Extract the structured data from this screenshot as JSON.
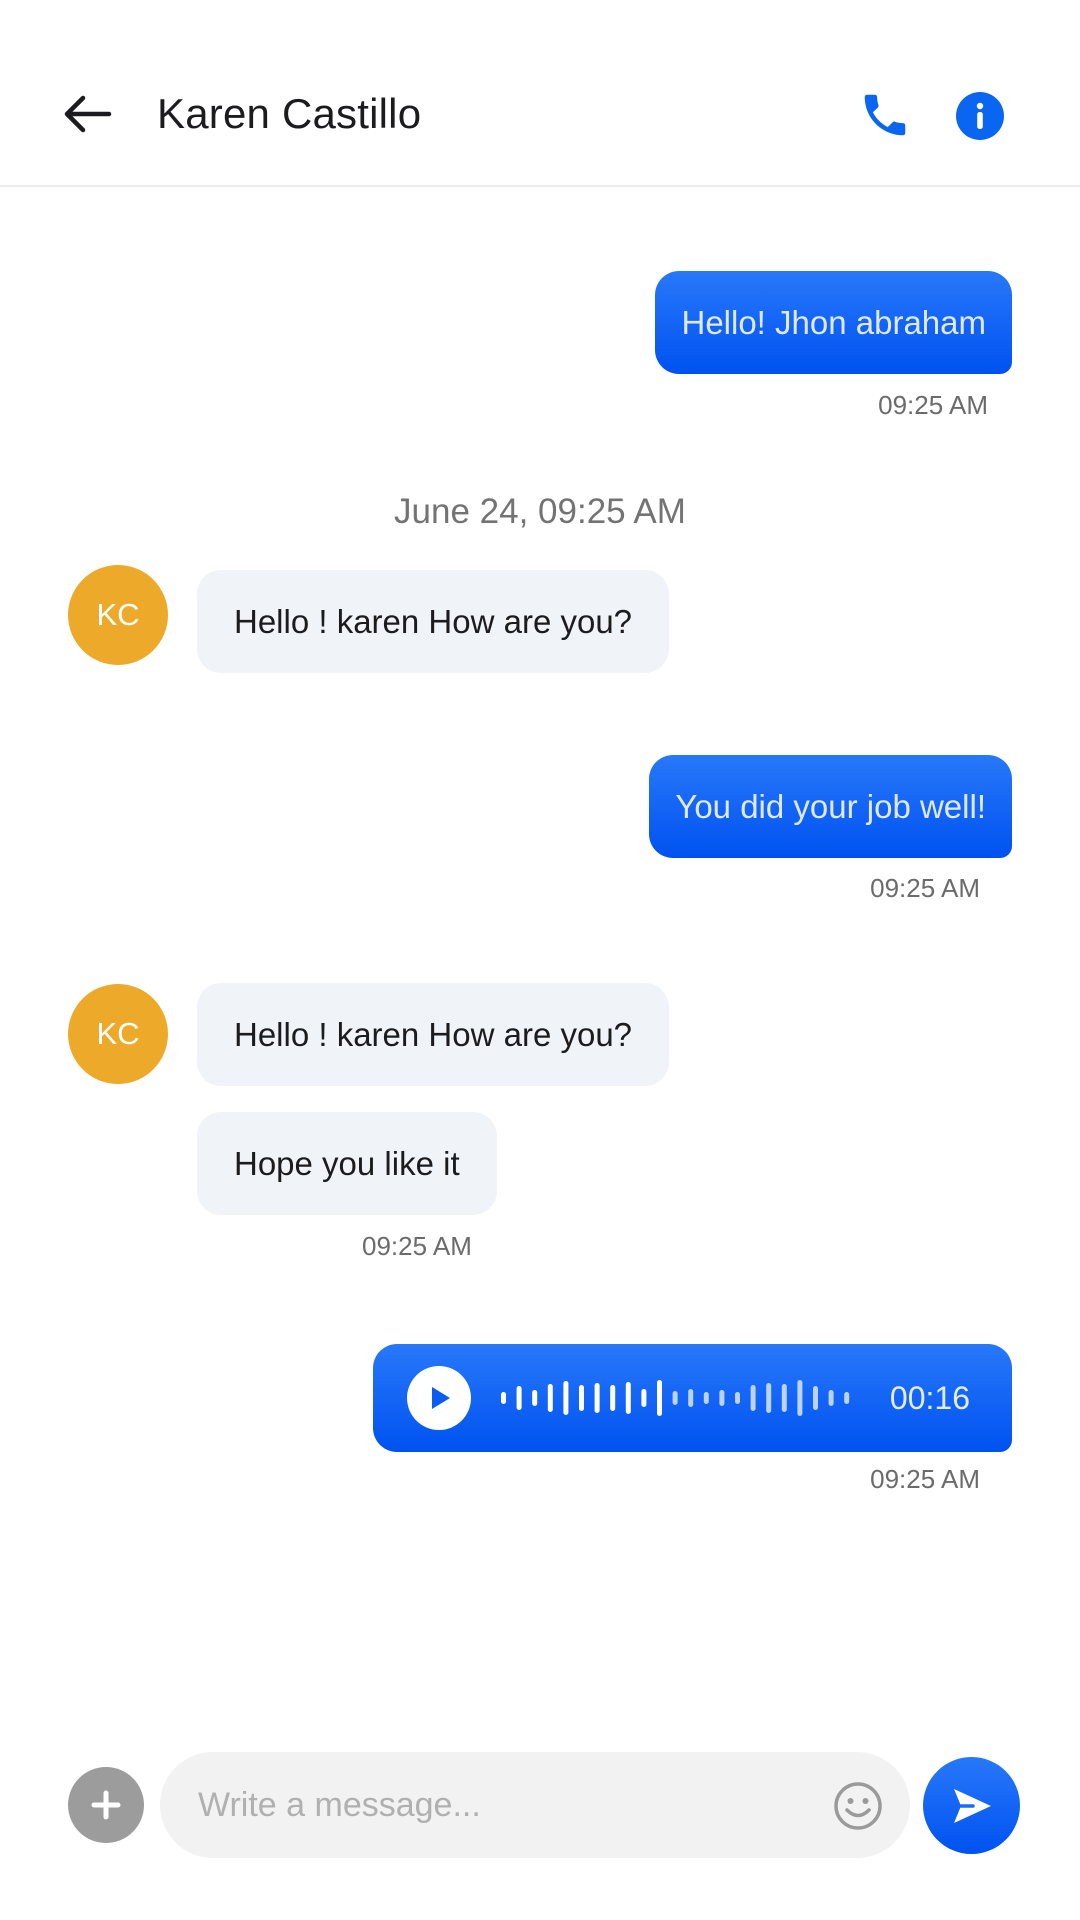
{
  "header": {
    "contact_name": "Karen Castillo",
    "back_icon": "arrow-left-icon",
    "call_icon": "phone-icon",
    "info_icon": "info-icon"
  },
  "date_separator": "June 24, 09:25 AM",
  "messages": [
    {
      "direction": "outgoing",
      "text": "Hello! Jhon abraham",
      "time": "09:25 AM"
    },
    {
      "direction": "incoming",
      "avatar": "KC",
      "text": "Hello ! karen How are you?"
    },
    {
      "direction": "outgoing",
      "text": "You did your job well!",
      "time": "09:25 AM"
    },
    {
      "direction": "incoming",
      "avatar": "KC",
      "text": "Hello ! karen How are you?"
    },
    {
      "direction": "incoming",
      "text": "Hope you like it",
      "time": "09:25 AM"
    },
    {
      "direction": "outgoing",
      "type": "voice",
      "duration": "00:16",
      "time": "09:25 AM"
    }
  ],
  "composer": {
    "placeholder": "Write a message...",
    "add_icon": "plus-icon",
    "emoji_icon": "smiley-icon",
    "send_icon": "send-icon"
  },
  "colors": {
    "accent": "#0a66f0",
    "avatar": "#edaa2a",
    "incoming_bubble": "#f0f4f8"
  }
}
